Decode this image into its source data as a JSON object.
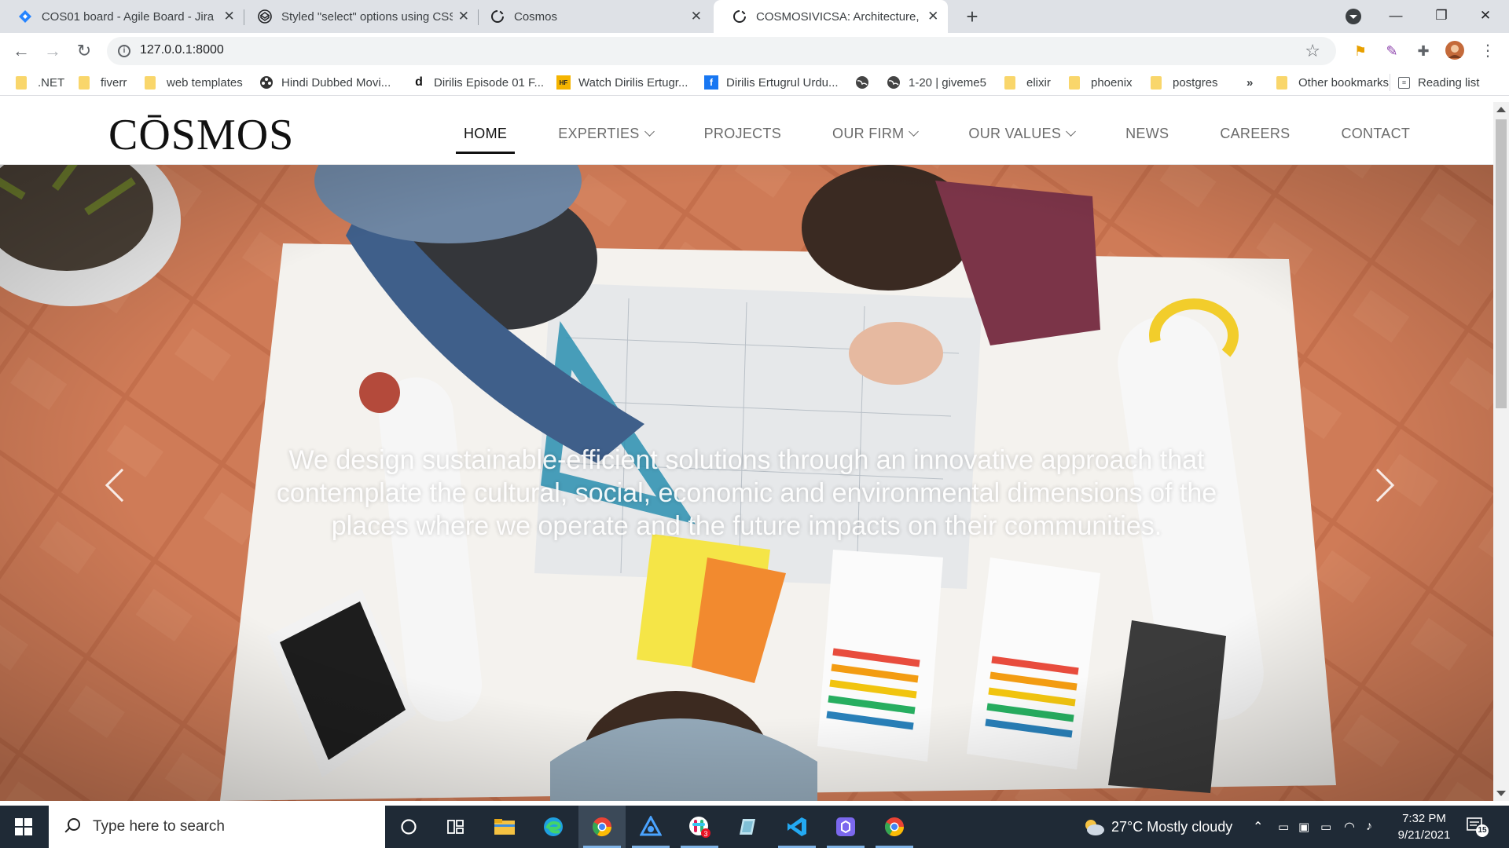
{
  "browser": {
    "tabs": [
      {
        "title": "COS01 board - Agile Board - Jira",
        "favicon": "jira-icon"
      },
      {
        "title": "Styled \"select\" options using CSS",
        "favicon": "codepen-icon"
      },
      {
        "title": "Cosmos",
        "favicon": "loading-icon"
      },
      {
        "title": "COSMOSIVICSA: Architecture, Engineering",
        "favicon": "loading-icon",
        "active": true
      }
    ],
    "url": "127.0.0.1:8000",
    "bookmarks": [
      {
        "label": ".NET",
        "type": "folder"
      },
      {
        "label": "fiverr",
        "type": "folder"
      },
      {
        "label": "web templates",
        "type": "folder"
      },
      {
        "label": "Hindi Dubbed Movi...",
        "type": "site"
      },
      {
        "label": "Dirilis Episode 01 F...",
        "type": "site"
      },
      {
        "label": "Watch Dirilis Ertugr...",
        "type": "site"
      },
      {
        "label": "Dirilis Ertugrul Urdu...",
        "type": "site"
      },
      {
        "label": "",
        "type": "site"
      },
      {
        "label": "1-20 | giveme5",
        "type": "site"
      },
      {
        "label": "elixir",
        "type": "folder"
      },
      {
        "label": "phoenix",
        "type": "folder"
      },
      {
        "label": "postgres",
        "type": "folder"
      }
    ],
    "overflow": "»",
    "other_bookmarks": "Other bookmarks",
    "reading_list": "Reading list"
  },
  "site": {
    "logo": "CŌSMOS",
    "nav": [
      {
        "label": "HOME",
        "active": true,
        "dropdown": false
      },
      {
        "label": "EXPERTIES",
        "dropdown": true
      },
      {
        "label": "PROJECTS",
        "dropdown": false
      },
      {
        "label": "OUR FIRM",
        "dropdown": true
      },
      {
        "label": "OUR VALUES",
        "dropdown": true
      },
      {
        "label": "NEWS",
        "dropdown": false
      },
      {
        "label": "CAREERS",
        "dropdown": false
      },
      {
        "label": "CONTACT",
        "dropdown": false
      }
    ],
    "hero": {
      "caption": "We design sustainable-efficient solutions through an innovative approach that contemplate the cultural, social, economic and environmental dimensions of the places where we operate and the future impacts on their communities."
    }
  },
  "taskbar": {
    "search_placeholder": "Type here to search",
    "weather": "27°C  Mostly cloudy",
    "time": "7:32 PM",
    "date": "9/21/2021",
    "notifications": "15"
  },
  "colors": {
    "tabstrip": "#dee1e6",
    "taskbar": "#1f2a36",
    "hero_floor": "#c97452",
    "folder": "#f9d66b"
  }
}
